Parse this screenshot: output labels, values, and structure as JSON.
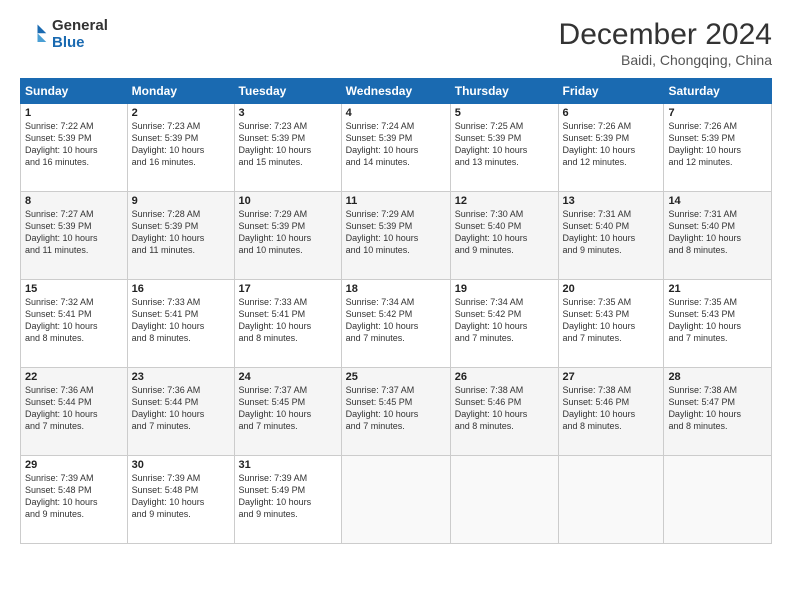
{
  "header": {
    "logo_general": "General",
    "logo_blue": "Blue",
    "month_title": "December 2024",
    "location": "Baidi, Chongqing, China"
  },
  "weekdays": [
    "Sunday",
    "Monday",
    "Tuesday",
    "Wednesday",
    "Thursday",
    "Friday",
    "Saturday"
  ],
  "weeks": [
    [
      {
        "day": "1",
        "info": "Sunrise: 7:22 AM\nSunset: 5:39 PM\nDaylight: 10 hours\nand 16 minutes."
      },
      {
        "day": "2",
        "info": "Sunrise: 7:23 AM\nSunset: 5:39 PM\nDaylight: 10 hours\nand 16 minutes."
      },
      {
        "day": "3",
        "info": "Sunrise: 7:23 AM\nSunset: 5:39 PM\nDaylight: 10 hours\nand 15 minutes."
      },
      {
        "day": "4",
        "info": "Sunrise: 7:24 AM\nSunset: 5:39 PM\nDaylight: 10 hours\nand 14 minutes."
      },
      {
        "day": "5",
        "info": "Sunrise: 7:25 AM\nSunset: 5:39 PM\nDaylight: 10 hours\nand 13 minutes."
      },
      {
        "day": "6",
        "info": "Sunrise: 7:26 AM\nSunset: 5:39 PM\nDaylight: 10 hours\nand 12 minutes."
      },
      {
        "day": "7",
        "info": "Sunrise: 7:26 AM\nSunset: 5:39 PM\nDaylight: 10 hours\nand 12 minutes."
      }
    ],
    [
      {
        "day": "8",
        "info": "Sunrise: 7:27 AM\nSunset: 5:39 PM\nDaylight: 10 hours\nand 11 minutes."
      },
      {
        "day": "9",
        "info": "Sunrise: 7:28 AM\nSunset: 5:39 PM\nDaylight: 10 hours\nand 11 minutes."
      },
      {
        "day": "10",
        "info": "Sunrise: 7:29 AM\nSunset: 5:39 PM\nDaylight: 10 hours\nand 10 minutes."
      },
      {
        "day": "11",
        "info": "Sunrise: 7:29 AM\nSunset: 5:39 PM\nDaylight: 10 hours\nand 10 minutes."
      },
      {
        "day": "12",
        "info": "Sunrise: 7:30 AM\nSunset: 5:40 PM\nDaylight: 10 hours\nand 9 minutes."
      },
      {
        "day": "13",
        "info": "Sunrise: 7:31 AM\nSunset: 5:40 PM\nDaylight: 10 hours\nand 9 minutes."
      },
      {
        "day": "14",
        "info": "Sunrise: 7:31 AM\nSunset: 5:40 PM\nDaylight: 10 hours\nand 8 minutes."
      }
    ],
    [
      {
        "day": "15",
        "info": "Sunrise: 7:32 AM\nSunset: 5:41 PM\nDaylight: 10 hours\nand 8 minutes."
      },
      {
        "day": "16",
        "info": "Sunrise: 7:33 AM\nSunset: 5:41 PM\nDaylight: 10 hours\nand 8 minutes."
      },
      {
        "day": "17",
        "info": "Sunrise: 7:33 AM\nSunset: 5:41 PM\nDaylight: 10 hours\nand 8 minutes."
      },
      {
        "day": "18",
        "info": "Sunrise: 7:34 AM\nSunset: 5:42 PM\nDaylight: 10 hours\nand 7 minutes."
      },
      {
        "day": "19",
        "info": "Sunrise: 7:34 AM\nSunset: 5:42 PM\nDaylight: 10 hours\nand 7 minutes."
      },
      {
        "day": "20",
        "info": "Sunrise: 7:35 AM\nSunset: 5:43 PM\nDaylight: 10 hours\nand 7 minutes."
      },
      {
        "day": "21",
        "info": "Sunrise: 7:35 AM\nSunset: 5:43 PM\nDaylight: 10 hours\nand 7 minutes."
      }
    ],
    [
      {
        "day": "22",
        "info": "Sunrise: 7:36 AM\nSunset: 5:44 PM\nDaylight: 10 hours\nand 7 minutes."
      },
      {
        "day": "23",
        "info": "Sunrise: 7:36 AM\nSunset: 5:44 PM\nDaylight: 10 hours\nand 7 minutes."
      },
      {
        "day": "24",
        "info": "Sunrise: 7:37 AM\nSunset: 5:45 PM\nDaylight: 10 hours\nand 7 minutes."
      },
      {
        "day": "25",
        "info": "Sunrise: 7:37 AM\nSunset: 5:45 PM\nDaylight: 10 hours\nand 7 minutes."
      },
      {
        "day": "26",
        "info": "Sunrise: 7:38 AM\nSunset: 5:46 PM\nDaylight: 10 hours\nand 8 minutes."
      },
      {
        "day": "27",
        "info": "Sunrise: 7:38 AM\nSunset: 5:46 PM\nDaylight: 10 hours\nand 8 minutes."
      },
      {
        "day": "28",
        "info": "Sunrise: 7:38 AM\nSunset: 5:47 PM\nDaylight: 10 hours\nand 8 minutes."
      }
    ],
    [
      {
        "day": "29",
        "info": "Sunrise: 7:39 AM\nSunset: 5:48 PM\nDaylight: 10 hours\nand 9 minutes."
      },
      {
        "day": "30",
        "info": "Sunrise: 7:39 AM\nSunset: 5:48 PM\nDaylight: 10 hours\nand 9 minutes."
      },
      {
        "day": "31",
        "info": "Sunrise: 7:39 AM\nSunset: 5:49 PM\nDaylight: 10 hours\nand 9 minutes."
      },
      null,
      null,
      null,
      null
    ]
  ]
}
